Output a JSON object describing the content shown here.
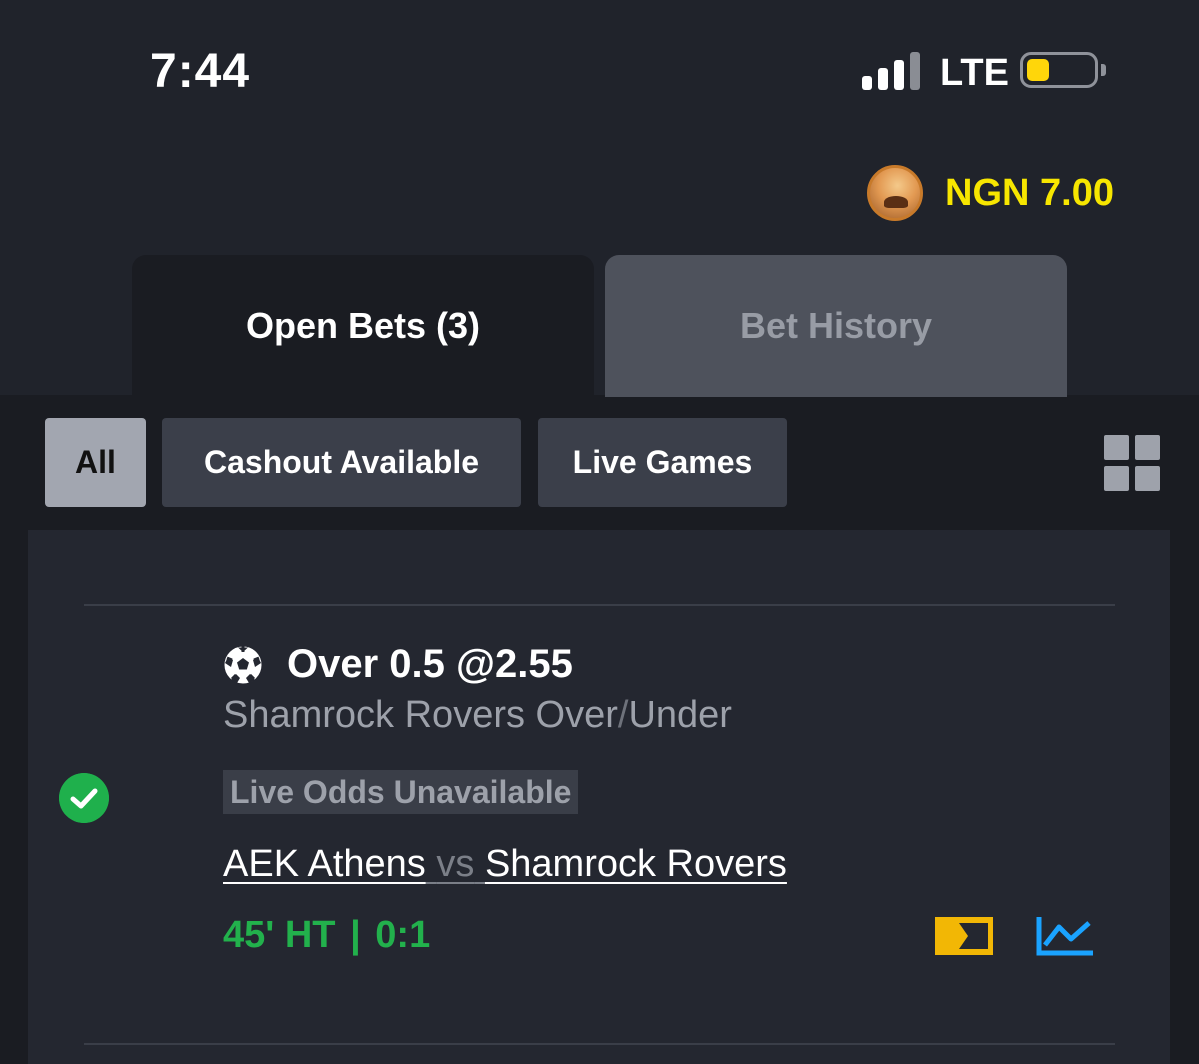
{
  "status_bar": {
    "time": "7:44",
    "network": "LTE",
    "icons": [
      "signal-icon",
      "battery-icon"
    ]
  },
  "account": {
    "balance": "NGN 7.00",
    "balance_color": "#f7e600"
  },
  "tabs": [
    {
      "label": "Open Bets (3)",
      "active": true
    },
    {
      "label": "Bet History",
      "active": false
    }
  ],
  "filters": [
    {
      "label": "All",
      "selected": true
    },
    {
      "label": "Cashout Available",
      "selected": false
    },
    {
      "label": "Live Games",
      "selected": false
    }
  ],
  "bet": {
    "sport_icon": "soccer-ball-icon",
    "status_icon": "check-circle-icon",
    "selection": "Over 0.5 @2.55",
    "market_team": "Shamrock Rovers Over",
    "market_slash": "/",
    "market_suffix": "Under",
    "odds_status": "Live Odds Unavailable",
    "home_team": "AEK Athens",
    "vs": "vs",
    "away_team": "Shamrock Rovers",
    "time_status": "45' HT",
    "separator": "|",
    "score": "0:1",
    "actions": [
      "match-tracker-icon",
      "stats-chart-icon"
    ]
  },
  "colors": {
    "background": "#20232b",
    "live_green": "#22b14c",
    "tracker_yellow": "#f2b705",
    "stats_blue": "#1aa3ff"
  }
}
